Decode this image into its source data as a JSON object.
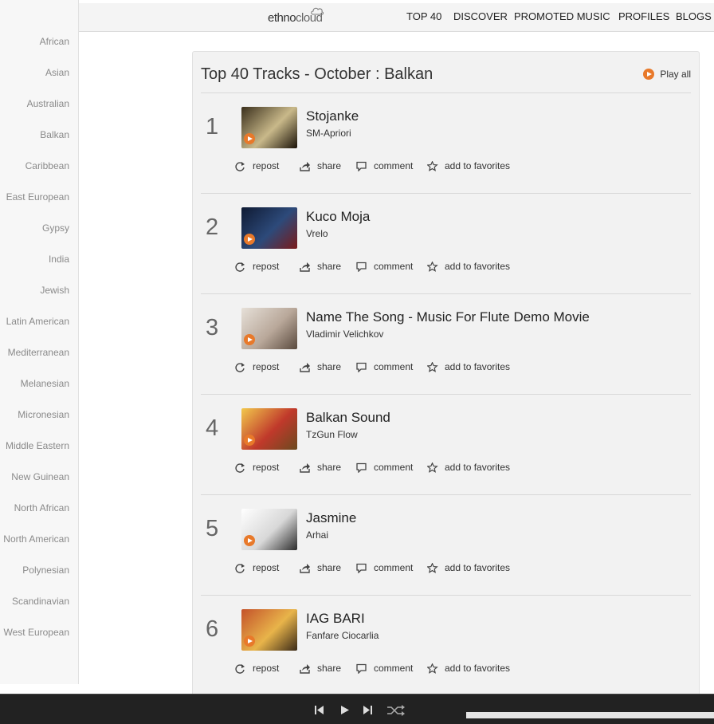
{
  "sidebar": {
    "items": [
      "African",
      "Asian",
      "Australian",
      "Balkan",
      "Caribbean",
      "East European",
      "Gypsy",
      "India",
      "Jewish",
      "Latin American",
      "Mediterranean",
      "Melanesian",
      "Micronesian",
      "Middle Eastern",
      "New Guinean",
      "North African",
      "North American",
      "Polynesian",
      "Scandinavian",
      "West European"
    ]
  },
  "header": {
    "logo_left": "ethno",
    "logo_right": "cloud",
    "nav": [
      "TOP 40",
      "DISCOVER",
      "PROMOTED MUSIC",
      "PROFILES",
      "BLOGS"
    ]
  },
  "panel": {
    "title": "Top 40 Tracks - October : Balkan",
    "play_all": "Play all"
  },
  "actions": {
    "repost": "repost",
    "share": "share",
    "comment": "comment",
    "favorite": "add to favorites"
  },
  "tracks": [
    {
      "rank": "1",
      "title": "Stojanke",
      "artist": "SM-Apriori",
      "thumb_colors": [
        "#3a2f1c",
        "#c9b98a",
        "#1a1208"
      ]
    },
    {
      "rank": "2",
      "title": "Kuco Moja",
      "artist": "Vrelo",
      "thumb_colors": [
        "#0f1a33",
        "#2d4a7a",
        "#7a1a1a"
      ]
    },
    {
      "rank": "3",
      "title": "Name The Song - Music For Flute Demo Movie",
      "artist": "Vladimir Velichkov",
      "thumb_colors": [
        "#e6e0d8",
        "#b9a89a",
        "#5a4a3e"
      ]
    },
    {
      "rank": "4",
      "title": "Balkan Sound",
      "artist": "TzGun Flow",
      "thumb_colors": [
        "#f2c94c",
        "#c0392b",
        "#6b4a1f"
      ]
    },
    {
      "rank": "5",
      "title": "Jasmine",
      "artist": "Arhai",
      "thumb_colors": [
        "#ffffff",
        "#d8d8d8",
        "#2b2b2b"
      ]
    },
    {
      "rank": "6",
      "title": "IAG BARI",
      "artist": "Fanfare Ciocarlia",
      "thumb_colors": [
        "#c4522a",
        "#e8b44a",
        "#3a2a18"
      ]
    }
  ],
  "player": {
    "progress": 1.0
  }
}
